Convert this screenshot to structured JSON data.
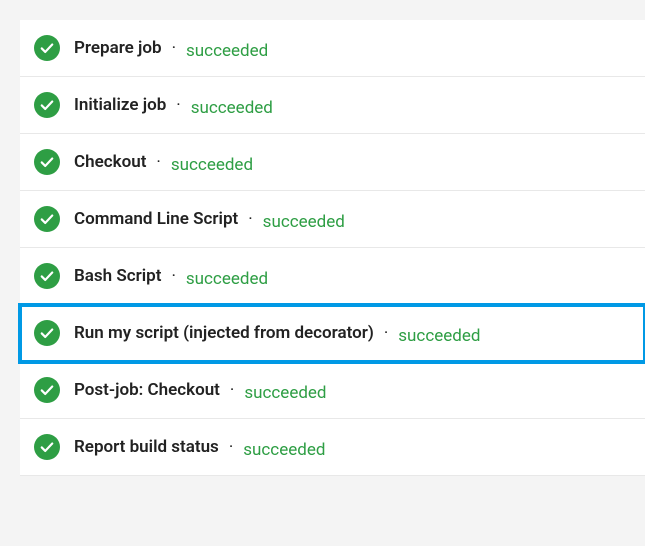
{
  "separator": "·",
  "status_color": "#2e9e44",
  "steps": [
    {
      "label": "Prepare job",
      "status": "succeeded",
      "highlighted": false
    },
    {
      "label": "Initialize job",
      "status": "succeeded",
      "highlighted": false
    },
    {
      "label": "Checkout",
      "status": "succeeded",
      "highlighted": false
    },
    {
      "label": "Command Line Script",
      "status": "succeeded",
      "highlighted": false
    },
    {
      "label": "Bash Script",
      "status": "succeeded",
      "highlighted": false
    },
    {
      "label": "Run my script (injected from decorator)",
      "status": "succeeded",
      "highlighted": true
    },
    {
      "label": "Post-job: Checkout",
      "status": "succeeded",
      "highlighted": false
    },
    {
      "label": "Report build status",
      "status": "succeeded",
      "highlighted": false
    }
  ]
}
